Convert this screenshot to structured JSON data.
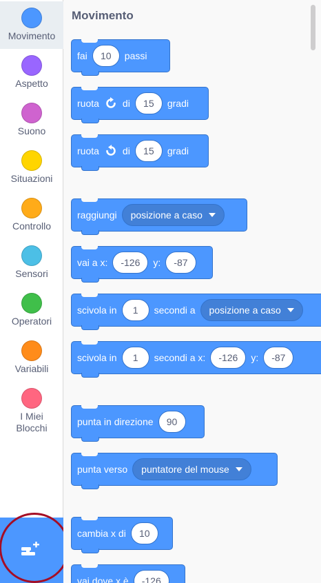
{
  "categories": [
    {
      "id": "motion",
      "label": "Movimento",
      "color": "#4c97ff",
      "selected": true
    },
    {
      "id": "looks",
      "label": "Aspetto",
      "color": "#9966ff",
      "selected": false
    },
    {
      "id": "sound",
      "label": "Suono",
      "color": "#cf63cf",
      "selected": false
    },
    {
      "id": "events",
      "label": "Situazioni",
      "color": "#ffd500",
      "selected": false
    },
    {
      "id": "control",
      "label": "Controllo",
      "color": "#ffab19",
      "selected": false
    },
    {
      "id": "sensing",
      "label": "Sensori",
      "color": "#4cbfe6",
      "selected": false
    },
    {
      "id": "operators",
      "label": "Operatori",
      "color": "#40bf4a",
      "selected": false
    },
    {
      "id": "variables",
      "label": "Variabili",
      "color": "#ff8c1a",
      "selected": false
    },
    {
      "id": "myblocks",
      "label": "I Miei\nBlocchi",
      "color": "#ff6680",
      "selected": false
    }
  ],
  "extension_button": {
    "icon": "add-extension-icon",
    "highlight_color": "#a50d25"
  },
  "palette": {
    "section_title": "Movimento",
    "blocks": {
      "move": {
        "label": "fai",
        "value": "10",
        "suffix": "passi"
      },
      "turn_right": {
        "label": "ruota",
        "icon": "rotate-clockwise-icon",
        "mid": "di",
        "value": "15",
        "suffix": "gradi"
      },
      "turn_left": {
        "label": "ruota",
        "icon": "rotate-counterclockwise-icon",
        "mid": "di",
        "value": "15",
        "suffix": "gradi"
      },
      "goto": {
        "label": "raggiungi",
        "menu": "posizione a caso"
      },
      "goto_xy": {
        "label": "vai a x:",
        "x": "-126",
        "ylabel": "y:",
        "y": "-87"
      },
      "glide_to": {
        "label": "scivola in",
        "secs": "1",
        "mid": "secondi a",
        "menu": "posizione a caso"
      },
      "glide_xy": {
        "label": "scivola in",
        "secs": "1",
        "mid": "secondi a x:",
        "x": "-126",
        "ylabel": "y:",
        "y": "-87"
      },
      "point_dir": {
        "label": "punta in direzione",
        "value": "90"
      },
      "point_towards": {
        "label": "punta verso",
        "menu": "puntatore del mouse"
      },
      "change_x": {
        "label": "cambia x di",
        "value": "10"
      },
      "set_x": {
        "label": "vai dove x è",
        "value": "-126"
      }
    }
  },
  "colors": {
    "motion": "#4c97ff",
    "motion_border": "#3373cc",
    "text": "#575e75"
  }
}
